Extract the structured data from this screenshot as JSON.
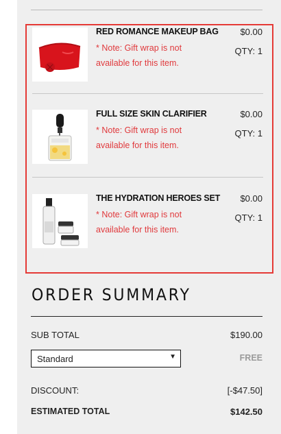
{
  "cart": {
    "items": [
      {
        "name": "RED ROMANCE MAKEUP BAG",
        "note": "* Note: Gift wrap is not available for this item.",
        "price": "$0.00",
        "qty": "QTY: 1",
        "image_icon": "red-makeup-bag-image"
      },
      {
        "name": "FULL SIZE SKIN CLARIFIER",
        "note": "* Note: Gift wrap is not available for this item.",
        "price": "$0.00",
        "qty": "QTY: 1",
        "image_icon": "serum-dropper-bottle-image"
      },
      {
        "name": "THE HYDRATION HEROES SET",
        "note": "* Note: Gift wrap is not available for this item.",
        "price": "$0.00",
        "qty": "QTY: 1",
        "image_icon": "skincare-set-image"
      }
    ]
  },
  "summary": {
    "title": "ORDER SUMMARY",
    "subtotal_label": "SUB TOTAL",
    "subtotal_value": "$190.00",
    "shipping_selected": "Standard",
    "shipping_cost": "FREE",
    "discount_label": "DISCOUNT:",
    "discount_value": "[-$47.50]",
    "estimated_label": "ESTIMATED TOTAL",
    "estimated_value": "$142.50"
  },
  "colors": {
    "highlight_border": "#e53935",
    "note_text": "#e0393c",
    "panel_bg": "#efefef"
  }
}
